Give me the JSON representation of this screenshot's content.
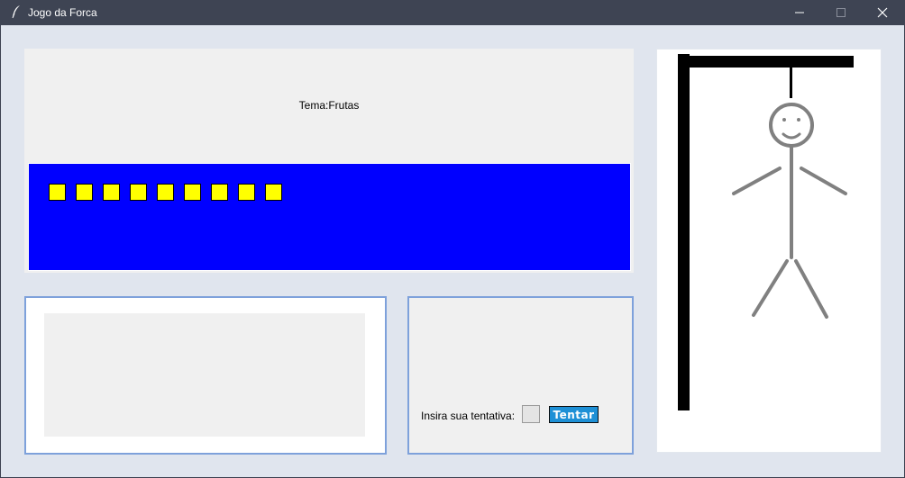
{
  "window": {
    "title": "Jogo da Forca",
    "controls": [
      "minimize",
      "maximize",
      "close"
    ]
  },
  "game": {
    "theme_label": "Tema:Frutas",
    "word_slots": [
      "",
      "",
      "",
      "",
      "",
      "",
      "",
      "",
      ""
    ],
    "wrong_letters": "",
    "guess": {
      "label": "Insira sua tentativa:",
      "value": "",
      "button_label": "Tentar"
    },
    "hangman_parts_drawn": [
      "head",
      "body",
      "left-arm",
      "right-arm",
      "left-leg",
      "right-leg"
    ]
  },
  "colors": {
    "title_bar": "#3e4453",
    "client_background": "#e0e5ee",
    "letters_bar": "#0000ff",
    "letter_slot": "#ffff00",
    "panel_border": "#7ea1db",
    "try_button": "#1e90d6",
    "gallows": "#000000",
    "hangman": "#808080"
  },
  "icons": {
    "app": "feather-icon",
    "minimize": "minimize-icon",
    "maximize": "maximize-icon",
    "close": "close-icon"
  }
}
